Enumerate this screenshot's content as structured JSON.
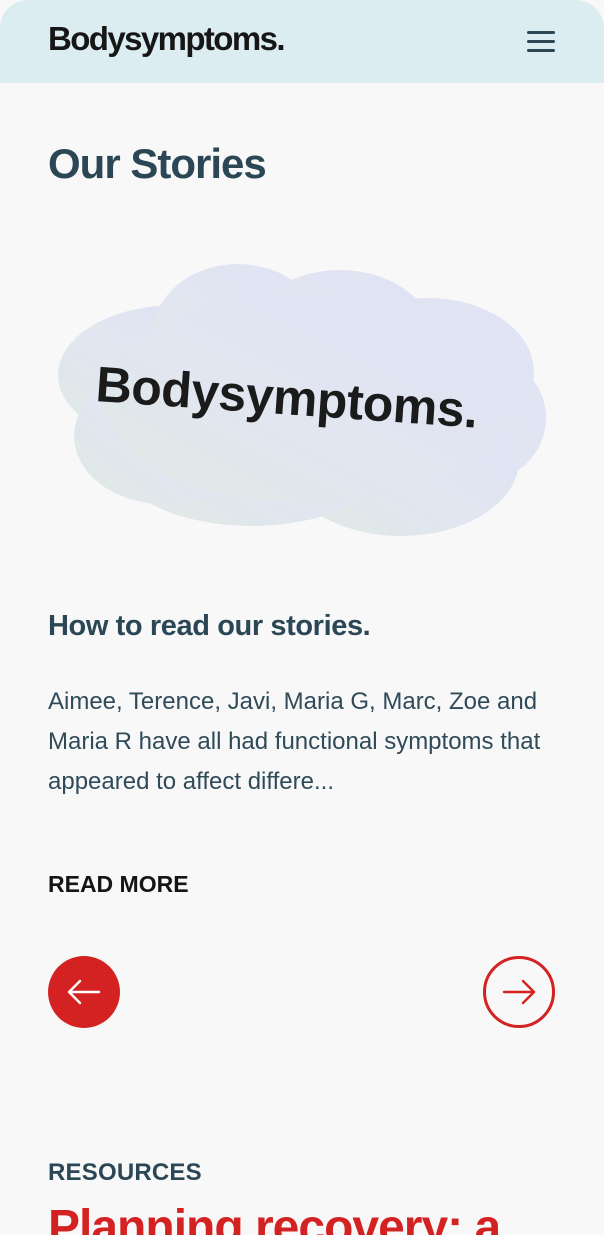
{
  "header": {
    "logo": "Bodysymptoms.",
    "menu_icon": "hamburger-menu-icon"
  },
  "main": {
    "title": "Our Stories",
    "story": {
      "image_text": "Bodysymptoms.",
      "title": "How to read our stories.",
      "excerpt": "Aimee, Terence, Javi, Maria G, Marc, Zoe and Maria R have all had functional symptoms that appeared to affect differe...",
      "read_more": "READ MORE"
    },
    "carousel": {
      "prev_icon": "arrow-left-icon",
      "next_icon": "arrow-right-icon"
    }
  },
  "resources": {
    "label": "RESOURCES",
    "title": "Planning recovery: a"
  },
  "colors": {
    "header_bg": "#dcedf2",
    "accent": "#d42222",
    "text": "#2b4756"
  }
}
